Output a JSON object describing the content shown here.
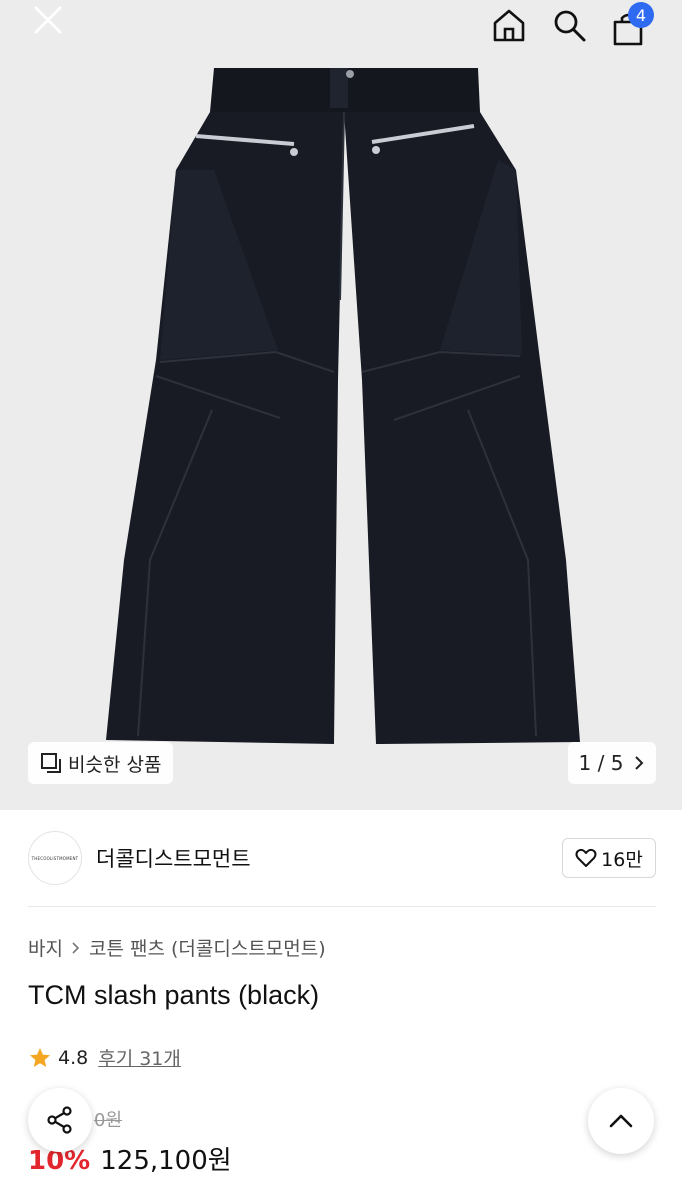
{
  "header": {
    "close_icon": "close-icon",
    "home_icon": "home-icon",
    "search_icon": "search-icon",
    "cart_icon": "shopping-bag-icon",
    "cart_count": "4"
  },
  "gallery": {
    "similar_label": "비슷한 상품",
    "current": "1",
    "separator": "/",
    "total": "5"
  },
  "brand": {
    "logo_text": "THECOOLISTMOMENT",
    "name": "더콜디스트모먼트",
    "like_count": "16만"
  },
  "breadcrumb": {
    "items": [
      "바지",
      "코튼 팬츠 (더콜디스트모먼트)"
    ]
  },
  "product": {
    "title": "TCM slash pants (black)",
    "rating": "4.8",
    "reviews": "후기 31개",
    "original_price": "0원",
    "discount": "10%",
    "price": "125,100원"
  },
  "colors": {
    "accent_blue": "#2f6bf2",
    "discount_red": "#e3262d",
    "star": "#f5a623"
  }
}
